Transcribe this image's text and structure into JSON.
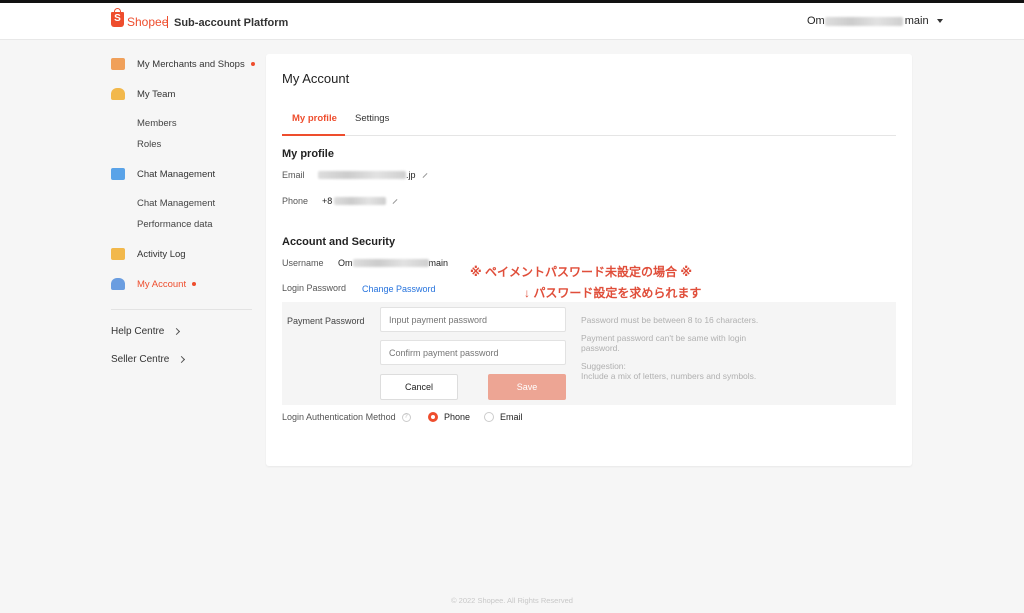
{
  "header": {
    "brand": "Shopee",
    "logo_letter": "S",
    "platform": "Sub-account Platform",
    "user_prefix": "Om",
    "user_suffix": "main"
  },
  "sidebar": {
    "items": [
      {
        "label": "My Merchants and Shops",
        "icon": "shop-icon",
        "icon_color": "#f0a05a",
        "dot": true
      },
      {
        "label": "My Team",
        "icon": "team-icon",
        "icon_color": "#f2b84b",
        "dot": false
      },
      {
        "label": "Chat Management",
        "icon": "chat-icon",
        "icon_color": "#5aa3e8",
        "dot": false
      },
      {
        "label": "Activity Log",
        "icon": "log-icon",
        "icon_color": "#f2b84b",
        "dot": false
      },
      {
        "label": "My Account",
        "icon": "account-icon",
        "icon_color": "#6a9de0",
        "dot": true
      }
    ],
    "team_sub": [
      "Members",
      "Roles"
    ],
    "chat_sub": [
      "Chat Management",
      "Performance data"
    ],
    "help_centre": "Help Centre",
    "seller_centre": "Seller Centre"
  },
  "main": {
    "title": "My Account",
    "tabs": [
      "My profile",
      "Settings"
    ],
    "profile_title": "My profile",
    "email_label": "Email",
    "email_suffix": ".jp",
    "phone_label": "Phone",
    "phone_prefix": "+8",
    "security_title": "Account and Security",
    "username_label": "Username",
    "username_prefix": "Om",
    "username_suffix": "main",
    "login_password_label": "Login Password",
    "change_password": "Change Password",
    "payment_password_label": "Payment Password",
    "input_placeholder": "Input payment password",
    "confirm_placeholder": "Confirm payment password",
    "cancel": "Cancel",
    "save": "Save",
    "hints": [
      "Password must be between 8 to 16 characters.",
      "Payment password can't be same with login password.",
      "Suggestion:",
      "Include a mix of letters, numbers and symbols."
    ],
    "auth_label": "Login Authentication Method",
    "auth_options": [
      "Phone",
      "Email"
    ],
    "auth_selected": "Phone"
  },
  "annotation": {
    "line1": "※ ペイメントパスワード未設定の場合 ※",
    "line2": "↓ パスワード設定を求められます"
  },
  "colors": {
    "accent": "#ee4d2d",
    "link": "#2673dd"
  },
  "footer": "© 2022 Shopee. All Rights Reserved"
}
